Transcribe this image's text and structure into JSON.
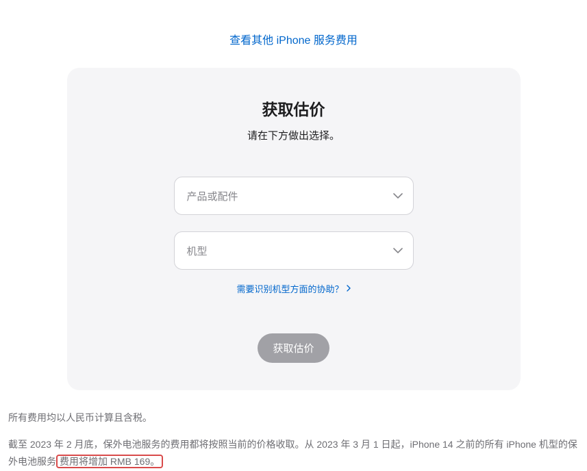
{
  "topLink": {
    "label": "查看其他 iPhone 服务费用"
  },
  "card": {
    "title": "获取估价",
    "subtitle": "请在下方做出选择。",
    "select1": {
      "placeholder": "产品或配件"
    },
    "select2": {
      "placeholder": "机型"
    },
    "helpLink": {
      "label": "需要识别机型方面的协助？"
    },
    "submit": {
      "label": "获取估价"
    }
  },
  "footer": {
    "line1": "所有费用均以人民币计算且含税。",
    "line2_pre": "截至 2023 年 2 月底，保外电池服务的费用都将按照当前的价格收取。从 2023 年 3 月 1 日起，iPhone 14 之前的所有 iPhone 机型的保外电池服务",
    "line2_highlight": "费用将增加 RMB 169。"
  }
}
